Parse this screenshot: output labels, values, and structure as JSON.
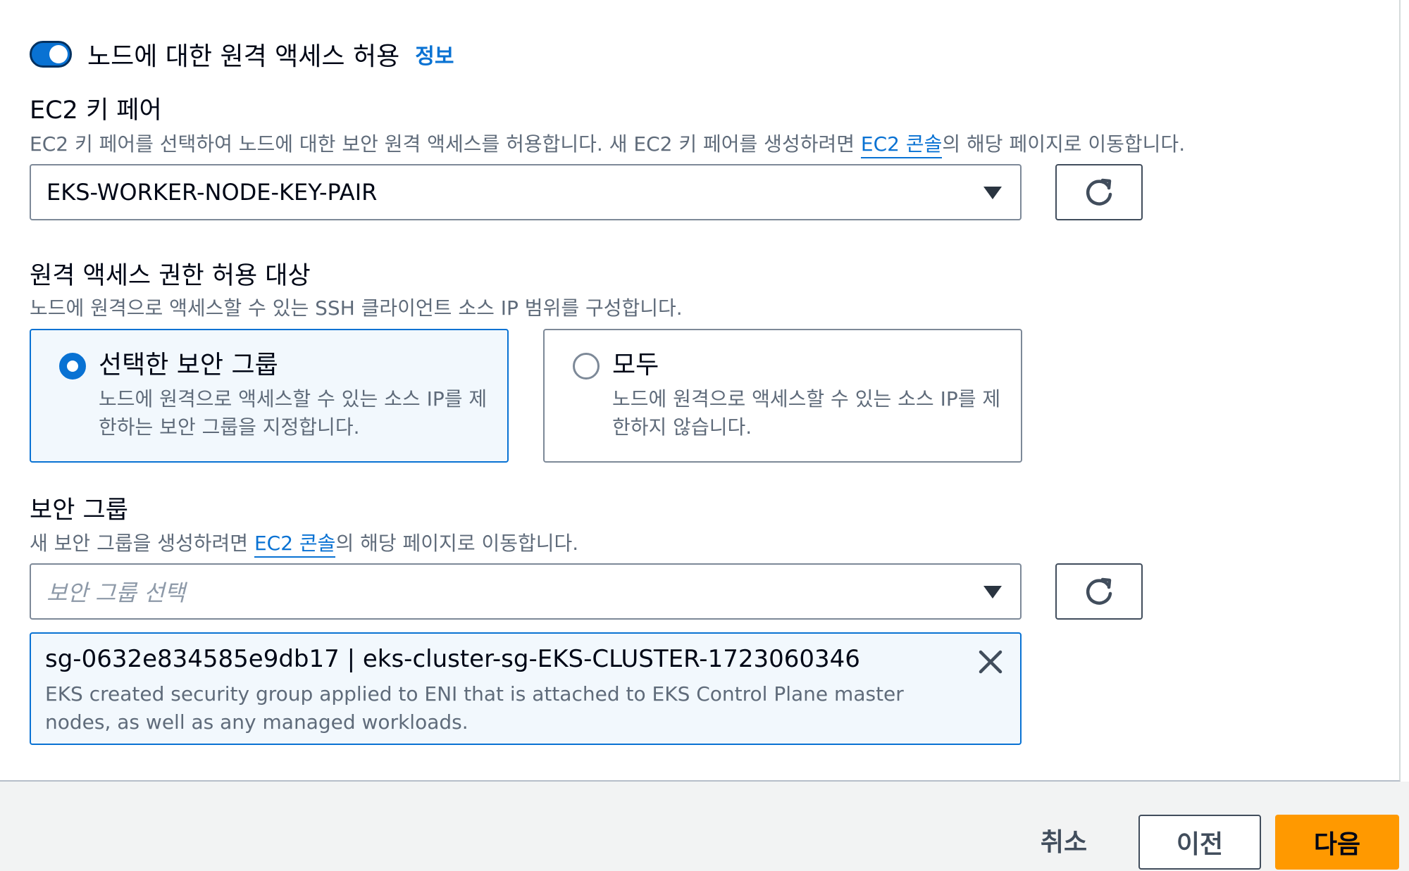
{
  "remote_access": {
    "toggle_label": "노드에 대한 원격 액세스 허용",
    "toggle_on": true,
    "info_link": "정보"
  },
  "key_pair": {
    "label": "EC2 키 페어",
    "description_before": "EC2 키 페어를 선택하여 노드에 대한 보안 원격 액세스를 허용합니다. 새 EC2 키 페어를 생성하려면 ",
    "description_link": "EC2 콘솔",
    "description_after": "의 해당 페이지로 이동합니다.",
    "selected_value": "EKS-WORKER-NODE-KEY-PAIR"
  },
  "access_target": {
    "label": "원격 액세스 권한 허용 대상",
    "description": "노드에 원격으로 액세스할 수 있는 SSH 클라이언트 소스 IP 범위를 구성합니다.",
    "options": [
      {
        "title": "선택한 보안 그룹",
        "description": "노드에 원격으로 액세스할 수 있는 소스 IP를 제한하는 보안 그룹을 지정합니다.",
        "selected": true
      },
      {
        "title": "모두",
        "description": "노드에 원격으로 액세스할 수 있는 소스 IP를 제한하지 않습니다.",
        "selected": false
      }
    ]
  },
  "security_group": {
    "label": "보안 그룹",
    "description_before": "새 보안 그룹을 생성하려면 ",
    "description_link": "EC2 콘솔",
    "description_after": "의 해당 페이지로 이동합니다.",
    "placeholder": "보안 그룹 선택",
    "token": {
      "title": "sg-0632e834585e9db17 | eks-cluster-sg-EKS-CLUSTER-1723060346",
      "description": "EKS created security group applied to ENI that is attached to EKS Control Plane master nodes, as well as any managed workloads."
    }
  },
  "footer": {
    "cancel_label": "취소",
    "previous_label": "이전",
    "next_label": "다음"
  },
  "colors": {
    "accent": "#0972d3",
    "primary_button": "#ff9900",
    "selected_bg": "#f2f8fd"
  },
  "icons": {
    "refresh": "refresh-icon",
    "caret": "caret-down-icon",
    "close": "close-icon"
  }
}
